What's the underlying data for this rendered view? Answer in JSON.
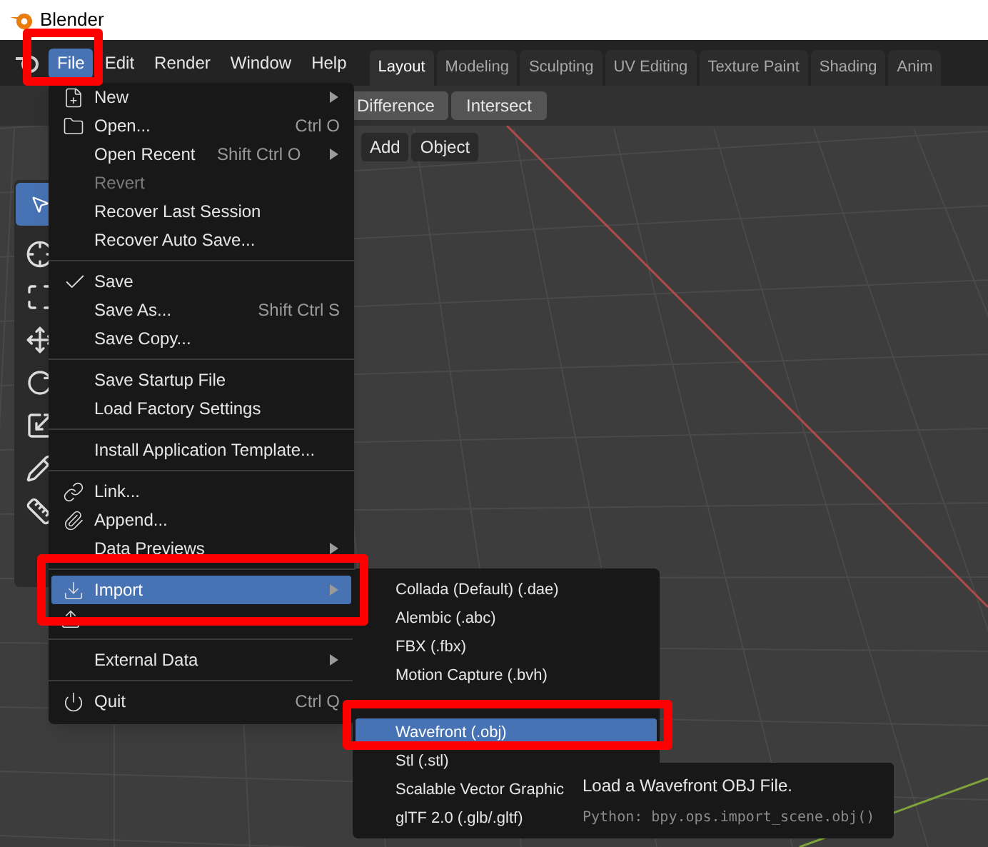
{
  "window": {
    "title": "Blender"
  },
  "menubar": [
    {
      "label": "File",
      "selected": true
    },
    {
      "label": "Edit",
      "selected": false
    },
    {
      "label": "Render",
      "selected": false
    },
    {
      "label": "Window",
      "selected": false
    },
    {
      "label": "Help",
      "selected": false
    }
  ],
  "workspace_tabs": [
    {
      "label": "Layout",
      "selected": true
    },
    {
      "label": "Modeling",
      "selected": false
    },
    {
      "label": "Sculpting",
      "selected": false
    },
    {
      "label": "UV Editing",
      "selected": false
    },
    {
      "label": "Texture Paint",
      "selected": false
    },
    {
      "label": "Shading",
      "selected": false
    },
    {
      "label": "Anim",
      "selected": false
    }
  ],
  "toolbar": {
    "buttons": [
      "Difference",
      "Intersect"
    ]
  },
  "header": {
    "buttons": [
      "Add",
      "Object"
    ]
  },
  "file_menu": {
    "items": [
      {
        "kind": "item",
        "label": "New",
        "submenu": true,
        "disabled": false,
        "selected": false
      },
      {
        "kind": "item",
        "label": "Open...",
        "shortcut": "Ctrl O",
        "submenu": false,
        "disabled": false,
        "selected": false
      },
      {
        "kind": "item",
        "label": "Open Recent",
        "shortcut": "Shift Ctrl O",
        "submenu": true,
        "disabled": false,
        "selected": false
      },
      {
        "kind": "item",
        "label": "Revert",
        "submenu": false,
        "disabled": true,
        "selected": false
      },
      {
        "kind": "item",
        "label": "Recover Last Session",
        "submenu": false,
        "disabled": false,
        "selected": false
      },
      {
        "kind": "item",
        "label": "Recover Auto Save...",
        "submenu": false,
        "disabled": false,
        "selected": false
      },
      {
        "kind": "separator"
      },
      {
        "kind": "item",
        "label": "Save",
        "submenu": false,
        "disabled": false,
        "selected": false
      },
      {
        "kind": "item",
        "label": "Save As...",
        "shortcut": "Shift Ctrl S",
        "submenu": false,
        "disabled": false,
        "selected": false
      },
      {
        "kind": "item",
        "label": "Save Copy...",
        "submenu": false,
        "disabled": false,
        "selected": false
      },
      {
        "kind": "separator"
      },
      {
        "kind": "item",
        "label": "Save Startup File",
        "submenu": false,
        "disabled": false,
        "selected": false
      },
      {
        "kind": "item",
        "label": "Load Factory Settings",
        "submenu": false,
        "disabled": false,
        "selected": false
      },
      {
        "kind": "separator"
      },
      {
        "kind": "item",
        "label": "Install Application Template...",
        "submenu": false,
        "disabled": false,
        "selected": false
      },
      {
        "kind": "separator"
      },
      {
        "kind": "item",
        "label": "Link...",
        "submenu": false,
        "disabled": false,
        "selected": false
      },
      {
        "kind": "item",
        "label": "Append...",
        "submenu": false,
        "disabled": false,
        "selected": false
      },
      {
        "kind": "item",
        "label": "Data Previews",
        "submenu": true,
        "disabled": false,
        "selected": false
      },
      {
        "kind": "separator"
      },
      {
        "kind": "item",
        "label": "Import",
        "submenu": true,
        "disabled": false,
        "selected": true
      },
      {
        "kind": "covered"
      },
      {
        "kind": "separator"
      },
      {
        "kind": "item",
        "label": "External Data",
        "submenu": true,
        "disabled": false,
        "selected": false
      },
      {
        "kind": "separator"
      },
      {
        "kind": "item",
        "label": "Quit",
        "shortcut": "Ctrl Q",
        "submenu": false,
        "disabled": false,
        "selected": false
      }
    ]
  },
  "import_submenu": {
    "items": [
      {
        "kind": "item",
        "label": "Collada (Default) (.dae)",
        "selected": false
      },
      {
        "kind": "item",
        "label": "Alembic (.abc)",
        "selected": false
      },
      {
        "kind": "item",
        "label": "FBX (.fbx)",
        "selected": false
      },
      {
        "kind": "item",
        "label": "Motion Capture (.bvh)",
        "selected": false
      },
      {
        "kind": "covered"
      },
      {
        "kind": "item",
        "label": "Wavefront (.obj)",
        "selected": true
      },
      {
        "kind": "item",
        "label": "Stl (.stl)",
        "selected": false
      },
      {
        "kind": "item",
        "label": "Scalable Vector Graphic",
        "selected": false
      },
      {
        "kind": "item",
        "label": "glTF 2.0 (.glb/.gltf)",
        "selected": false
      }
    ]
  },
  "tooltip": {
    "description": "Load a Wavefront OBJ File.",
    "python": "Python: bpy.ops.import_scene.obj()"
  }
}
